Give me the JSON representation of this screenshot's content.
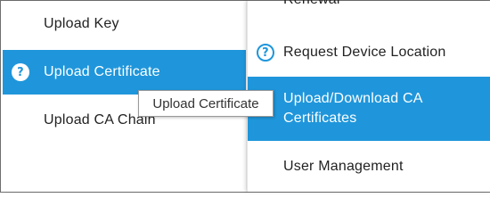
{
  "left_menu": {
    "items": [
      {
        "label": "Upload Key",
        "active": false,
        "icon": null
      },
      {
        "label": "Upload Certificate",
        "active": true,
        "icon": "help-icon"
      },
      {
        "label": "Upload CA Chain",
        "active": false,
        "icon": null
      }
    ]
  },
  "right_menu": {
    "items": [
      {
        "label": "Renewal",
        "active": false,
        "icon": null
      },
      {
        "label": "Request Device Location",
        "active": false,
        "icon": "help-icon"
      },
      {
        "label": "Upload/Download CA Certificates",
        "active": true,
        "icon": null
      },
      {
        "label": "User Management",
        "active": false,
        "icon": null
      }
    ]
  },
  "tooltip": {
    "text": "Upload Certificate"
  },
  "icons": {
    "help_glyph": "?"
  },
  "colors": {
    "accent": "#1f96db",
    "text": "#222222",
    "background": "#ffffff"
  }
}
